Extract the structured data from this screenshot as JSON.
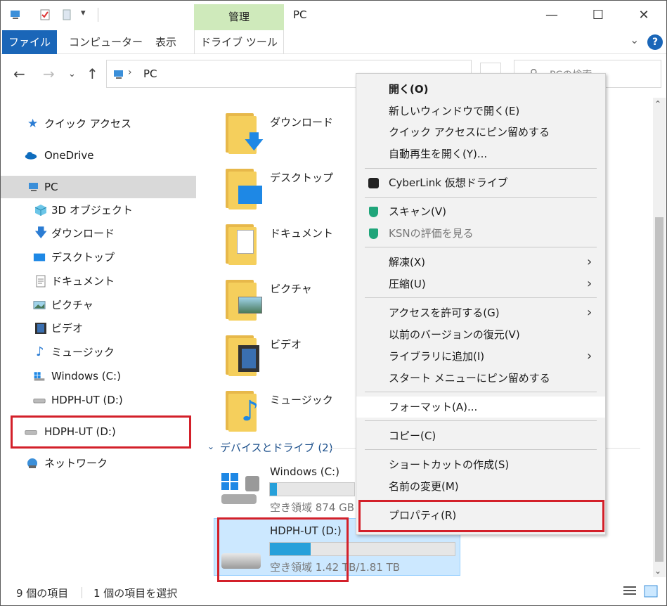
{
  "title_bar": {
    "title": "PC",
    "management_tab": "管理",
    "minimize": "—",
    "maximize": "☐",
    "close": "✕"
  },
  "ribbon": {
    "file_tab": "ファイル",
    "computer_tab": "コンピューター",
    "view_tab": "表示",
    "drive_tools_tab": "ドライブ ツール",
    "help": "?"
  },
  "address": {
    "path": "PC",
    "search_placeholder": "PCの検索"
  },
  "sidebar": {
    "items": [
      {
        "label": "クイック アクセス",
        "icon": "star-icon"
      },
      {
        "label": "OneDrive",
        "icon": "cloud-icon"
      },
      {
        "label": "PC",
        "icon": "pc-icon"
      },
      {
        "label": "3D オブジェクト",
        "icon": "cube-icon"
      },
      {
        "label": "ダウンロード",
        "icon": "download-icon"
      },
      {
        "label": "デスクトップ",
        "icon": "desktop-icon"
      },
      {
        "label": "ドキュメント",
        "icon": "document-icon"
      },
      {
        "label": "ピクチャ",
        "icon": "picture-icon"
      },
      {
        "label": "ビデオ",
        "icon": "video-icon"
      },
      {
        "label": "ミュージック",
        "icon": "music-icon"
      },
      {
        "label": "Windows (C:)",
        "icon": "drive-c-icon"
      },
      {
        "label": "HDPH-UT (D:)",
        "icon": "drive-icon"
      },
      {
        "label": "HDPH-UT (D:)",
        "icon": "drive-icon"
      },
      {
        "label": "ネットワーク",
        "icon": "network-icon"
      }
    ]
  },
  "content": {
    "folders": [
      {
        "label": "ダウンロード"
      },
      {
        "label": "デスクトップ"
      },
      {
        "label": "ドキュメント"
      },
      {
        "label": "ピクチャ"
      },
      {
        "label": "ビデオ"
      },
      {
        "label": "ミュージック"
      }
    ],
    "group_header": "デバイスとドライブ (2)",
    "drives": [
      {
        "name": "Windows (C:)",
        "space": "空き領域 874 GB",
        "used_fraction": 0.08
      },
      {
        "name": "HDPH-UT (D:)",
        "space": "空き領域 1.42 TB/1.81 TB",
        "used_fraction": 0.22
      }
    ]
  },
  "status_bar": {
    "item_count": "9 個の項目",
    "selected": "1 個の項目を選択"
  },
  "context_menu": {
    "items": [
      {
        "label": "開く(O)"
      },
      {
        "label": "新しいウィンドウで開く(E)"
      },
      {
        "label": "クイック アクセスにピン留めする"
      },
      {
        "label": "自動再生を開く(Y)..."
      },
      {
        "label": "CyberLink 仮想ドライブ"
      },
      {
        "label": "スキャン(V)"
      },
      {
        "label": "KSNの評価を見る"
      },
      {
        "label": "解凍(X)"
      },
      {
        "label": "圧縮(U)"
      },
      {
        "label": "アクセスを許可する(G)"
      },
      {
        "label": "以前のバージョンの復元(V)"
      },
      {
        "label": "ライブラリに追加(I)"
      },
      {
        "label": "スタート メニューにピン留めする"
      },
      {
        "label": "フォーマット(A)..."
      },
      {
        "label": "コピー(C)"
      },
      {
        "label": "ショートカットの作成(S)"
      },
      {
        "label": "名前の変更(M)"
      },
      {
        "label": "プロパティ(R)"
      }
    ],
    "submenu_arrow": "›"
  },
  "colors": {
    "accent": "#1a66b8",
    "highlight_red": "#d3202a",
    "selection": "#cce8ff",
    "progress": "#26a0da"
  }
}
